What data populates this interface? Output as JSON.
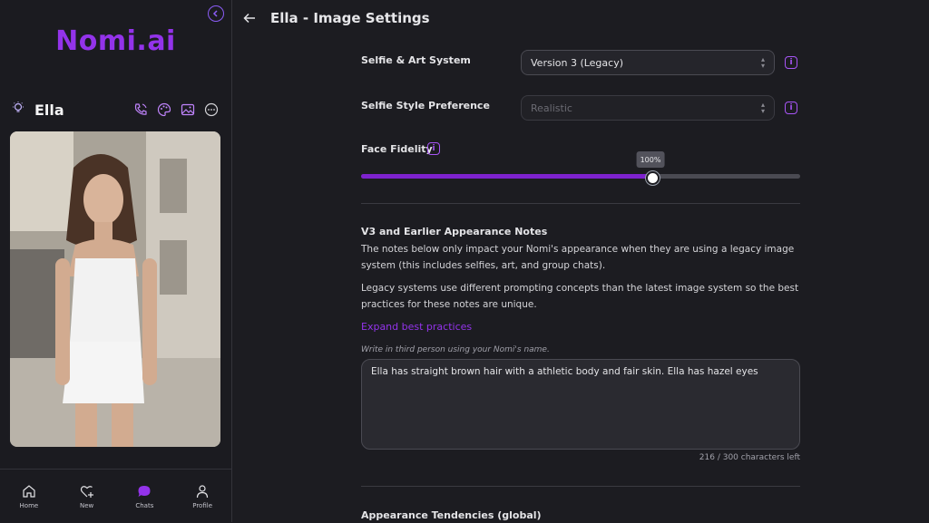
{
  "sidebar": {
    "logo": "Nomi.ai",
    "profile": {
      "name": "Ella"
    },
    "nav": [
      {
        "label": "Home",
        "icon": "home-icon"
      },
      {
        "label": "New",
        "icon": "heart-plus-icon"
      },
      {
        "label": "Chats",
        "icon": "chat-bubble-icon",
        "active": true
      },
      {
        "label": "Profile",
        "icon": "person-icon"
      }
    ]
  },
  "header": {
    "title": "Ella - Image Settings"
  },
  "settings": {
    "selfie_art_system": {
      "label": "Selfie & Art System",
      "value": "Version 3 (Legacy)"
    },
    "selfie_style": {
      "label": "Selfie Style Preference",
      "value": "Realistic"
    },
    "face_fidelity": {
      "label": "Face Fidelity",
      "value_text": "100%",
      "level": 0.66
    }
  },
  "notes": {
    "title": "V3 and Earlier Appearance Notes",
    "para1": "The notes below only impact your Nomi's appearance when they are using a legacy image system (this includes selfies, art, and group chats).",
    "para2": "Legacy systems use different prompting concepts than the latest image system so the best practices for these notes are unique.",
    "expand_link": "Expand best practices",
    "hint": "Write in third person using your Nomi's name.",
    "text": "Ella has straight brown hair with a athletic body and fair skin. Ella has hazel eyes",
    "char_count": "216 / 300 characters left"
  },
  "next_section": {
    "title": "Appearance Tendencies (global)"
  },
  "colors": {
    "accent": "#9333ea",
    "background": "#1c1c21",
    "slider_fill": "#7e22ce"
  }
}
